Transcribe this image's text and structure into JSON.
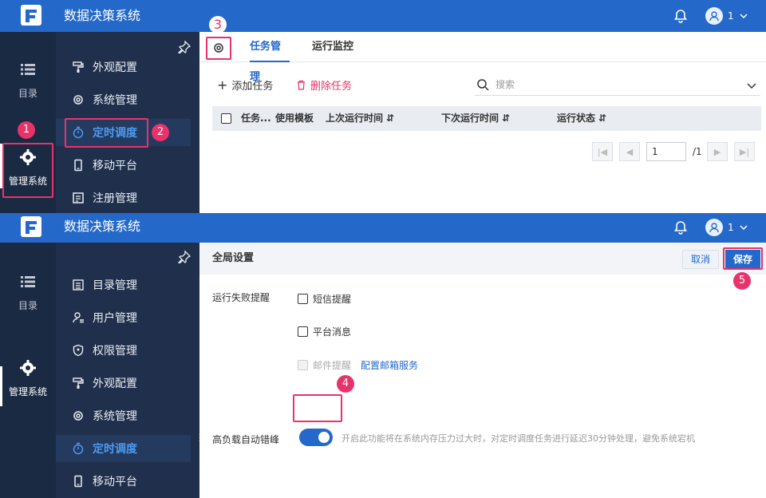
{
  "app": {
    "title": "数据决策系统",
    "user_label": "1",
    "brand_color": "#2469c9",
    "annotation_color": "#e8336a"
  },
  "panel1": {
    "rail": {
      "directory": "目录",
      "manage": "管理系统"
    },
    "menu": [
      {
        "label": "外观配置",
        "icon": "paint-roller-icon"
      },
      {
        "label": "系统管理",
        "icon": "gear-icon"
      },
      {
        "label": "定时调度",
        "icon": "timer-icon",
        "active": true
      },
      {
        "label": "移动平台",
        "icon": "mobile-icon"
      },
      {
        "label": "注册管理",
        "icon": "register-icon"
      }
    ],
    "tabs": [
      "任务管理",
      "运行监控"
    ],
    "toolbar": {
      "add": "添加任务",
      "delete": "删除任务",
      "search_placeholder": "搜索"
    },
    "columns": [
      "任务...",
      "使用模板",
      "上次运行时间",
      "下次运行时间",
      "运行状态"
    ],
    "pager": {
      "page": "1",
      "total": "/1"
    },
    "badges": [
      "1",
      "2",
      "3"
    ]
  },
  "panel2": {
    "rail": {
      "directory": "目录",
      "manage": "管理系统"
    },
    "menu": [
      {
        "label": "目录管理",
        "icon": "list-icon"
      },
      {
        "label": "用户管理",
        "icon": "user-icon"
      },
      {
        "label": "权限管理",
        "icon": "shield-icon"
      },
      {
        "label": "外观配置",
        "icon": "paint-roller-icon"
      },
      {
        "label": "系统管理",
        "icon": "gear-icon"
      },
      {
        "label": "定时调度",
        "icon": "timer-icon",
        "active": true
      },
      {
        "label": "移动平台",
        "icon": "mobile-icon"
      }
    ],
    "global": {
      "title": "全局设置",
      "cancel": "取消",
      "save": "保存",
      "fail_label": "运行失败提醒",
      "sms": "短信提醒",
      "platform": "平台消息",
      "email": "邮件提醒",
      "email_link": "配置邮箱服务",
      "overload_label": "高负载自动错峰",
      "overload_enabled": true,
      "overload_hint": "开启此功能将在系统内存压力过大时，对定时调度任务进行延迟30分钟处理，避免系统宕机"
    },
    "badges": [
      "4",
      "5"
    ]
  }
}
